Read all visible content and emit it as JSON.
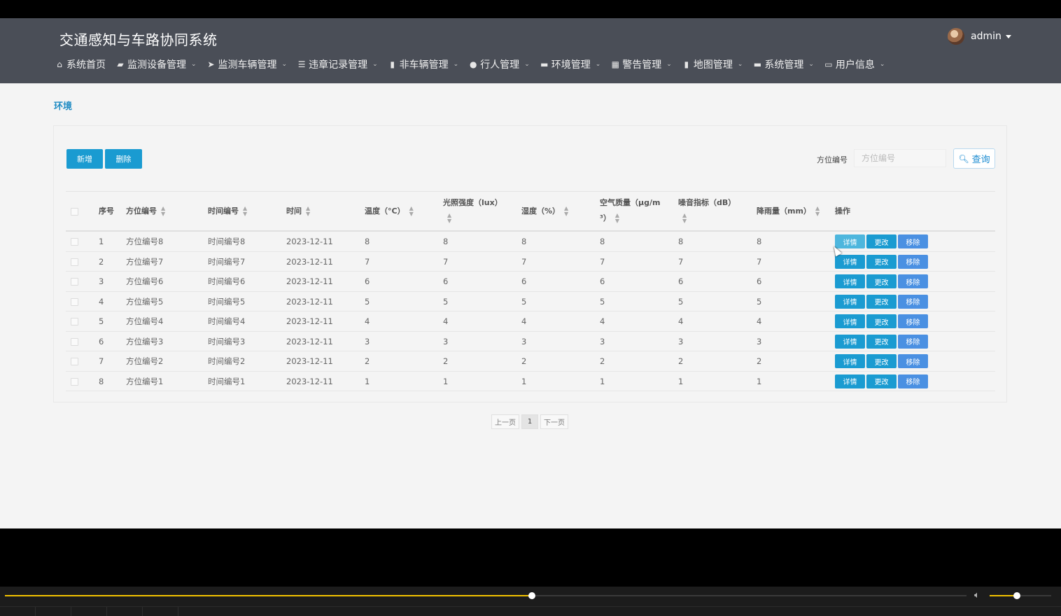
{
  "header": {
    "title": "交通感知与车路协同系统",
    "user": "admin"
  },
  "nav": [
    {
      "label": "系统首页",
      "icon": "⌂",
      "icon_name": "home-icon",
      "dropdown": false
    },
    {
      "label": "监测设备管理",
      "icon": "▰",
      "icon_name": "briefcase-icon",
      "dropdown": true
    },
    {
      "label": "监测车辆管理",
      "icon": "➤",
      "icon_name": "send-icon",
      "dropdown": true
    },
    {
      "label": "违章记录管理",
      "icon": "☰",
      "icon_name": "sliders-icon",
      "dropdown": true
    },
    {
      "label": "非车辆管理",
      "icon": "▮",
      "icon_name": "book-icon",
      "dropdown": true
    },
    {
      "label": "行人管理",
      "icon": "●",
      "icon_name": "user-icon",
      "dropdown": true
    },
    {
      "label": "环境管理",
      "icon": "▬",
      "icon_name": "comment-icon",
      "dropdown": true
    },
    {
      "label": "警告管理",
      "icon": "▦",
      "icon_name": "grid-icon",
      "dropdown": true
    },
    {
      "label": "地图管理",
      "icon": "▮",
      "icon_name": "clipboard-icon",
      "dropdown": true
    },
    {
      "label": "系统管理",
      "icon": "▬",
      "icon_name": "monitor-icon",
      "dropdown": true
    },
    {
      "label": "用户信息",
      "icon": "▭",
      "icon_name": "card-icon",
      "dropdown": true
    }
  ],
  "page": {
    "title": "环境",
    "add_label": "新增",
    "delete_label": "删除",
    "search_label": "方位编号",
    "search_placeholder": "方位编号",
    "search_button": "查询"
  },
  "table": {
    "columns": [
      {
        "label": "序号",
        "sortable": false
      },
      {
        "label": "方位编号",
        "sortable": true
      },
      {
        "label": "时间编号",
        "sortable": true
      },
      {
        "label": "时间",
        "sortable": true
      },
      {
        "label": "温度（°C）",
        "sortable": true
      },
      {
        "label": "光照强度（lux）",
        "sortable": true
      },
      {
        "label": "湿度（%）",
        "sortable": true
      },
      {
        "label": "空气质量（μg/m³）",
        "sortable": true
      },
      {
        "label": "噪音指标（dB）",
        "sortable": true
      },
      {
        "label": "降雨量（mm）",
        "sortable": true
      },
      {
        "label": "操作",
        "sortable": false
      }
    ],
    "header_text": {
      "c0": "序号",
      "c1": "方位编号",
      "c2": "时间编号",
      "c3": "时间",
      "c4": "温度（°C）",
      "c5": "光照强度（lux）",
      "c6": "湿度（%）",
      "c7a": "空气质量（μg/m",
      "c7b": "³）",
      "c8": "噪音指标（dB）",
      "c9": "降雨量（mm）",
      "c10": "操作"
    },
    "rows": [
      {
        "no": "1",
        "loc": "方位编号8",
        "tid": "时间编号8",
        "date": "2023-12-11",
        "temp": "8",
        "lux": "8",
        "hum": "8",
        "air": "8",
        "noise": "8",
        "rain": "8"
      },
      {
        "no": "2",
        "loc": "方位编号7",
        "tid": "时间编号7",
        "date": "2023-12-11",
        "temp": "7",
        "lux": "7",
        "hum": "7",
        "air": "7",
        "noise": "7",
        "rain": "7"
      },
      {
        "no": "3",
        "loc": "方位编号6",
        "tid": "时间编号6",
        "date": "2023-12-11",
        "temp": "6",
        "lux": "6",
        "hum": "6",
        "air": "6",
        "noise": "6",
        "rain": "6"
      },
      {
        "no": "4",
        "loc": "方位编号5",
        "tid": "时间编号5",
        "date": "2023-12-11",
        "temp": "5",
        "lux": "5",
        "hum": "5",
        "air": "5",
        "noise": "5",
        "rain": "5"
      },
      {
        "no": "5",
        "loc": "方位编号4",
        "tid": "时间编号4",
        "date": "2023-12-11",
        "temp": "4",
        "lux": "4",
        "hum": "4",
        "air": "4",
        "noise": "4",
        "rain": "4"
      },
      {
        "no": "6",
        "loc": "方位编号3",
        "tid": "时间编号3",
        "date": "2023-12-11",
        "temp": "3",
        "lux": "3",
        "hum": "3",
        "air": "3",
        "noise": "3",
        "rain": "3"
      },
      {
        "no": "7",
        "loc": "方位编号2",
        "tid": "时间编号2",
        "date": "2023-12-11",
        "temp": "2",
        "lux": "2",
        "hum": "2",
        "air": "2",
        "noise": "2",
        "rain": "2"
      },
      {
        "no": "8",
        "loc": "方位编号1",
        "tid": "时间编号1",
        "date": "2023-12-11",
        "temp": "1",
        "lux": "1",
        "hum": "1",
        "air": "1",
        "noise": "1",
        "rain": "1"
      }
    ],
    "row_actions": {
      "detail": "详情",
      "edit": "更改",
      "remove": "移除"
    }
  },
  "pagination": {
    "prev": "上一页",
    "current": "1",
    "next": "下一页"
  },
  "player": {
    "progress": 0.548,
    "volume": 0.44
  },
  "colors": {
    "header_bg": "#4a4e57",
    "accent": "#1a9bd1",
    "remove": "#4a90e2",
    "progress": "#f2c200"
  }
}
